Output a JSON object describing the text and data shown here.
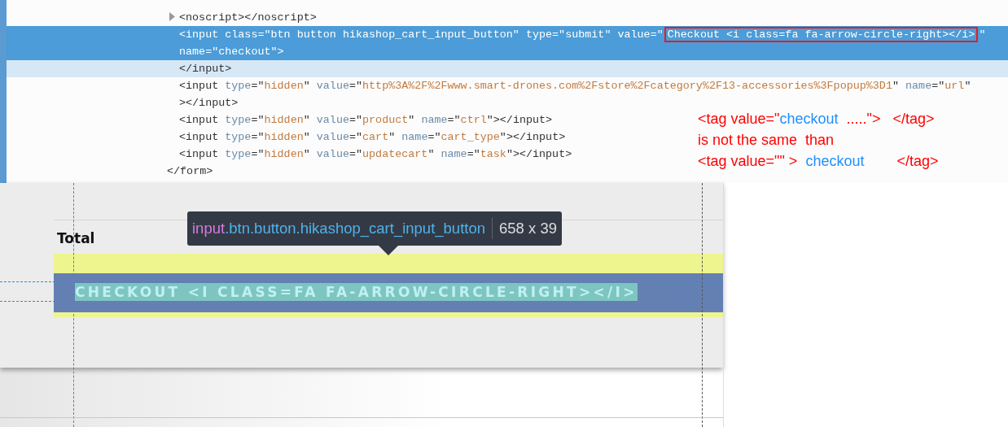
{
  "elements_panel": {
    "form_children": [
      {
        "selected": false,
        "hovered": false,
        "expanded": false,
        "rows": [
          {
            "tokens": [
              {
                "kind": "tag",
                "text": "<noscript></noscript>"
              }
            ]
          }
        ]
      },
      {
        "selected": true,
        "hovered": false,
        "rows": [
          {
            "tokens": [
              {
                "kind": "tag",
                "text": "<input "
              },
              {
                "kind": "attr",
                "text": "class"
              },
              {
                "kind": "tag",
                "text": "=\""
              },
              {
                "kind": "value",
                "text": "btn button hikashop_cart_input_button"
              },
              {
                "kind": "tag",
                "text": "\" "
              },
              {
                "kind": "attr",
                "text": "type"
              },
              {
                "kind": "tag",
                "text": "=\""
              },
              {
                "kind": "value",
                "text": "submit"
              },
              {
                "kind": "tag",
                "text": "\" "
              },
              {
                "kind": "attr",
                "text": "value"
              },
              {
                "kind": "tag",
                "text": "=\""
              },
              {
                "kind": "boxed",
                "text": "Checkout <i class=fa fa-arrow-circle-right></i>"
              },
              {
                "kind": "tag",
                "text": "\""
              }
            ]
          },
          {
            "tokens": [
              {
                "kind": "attr",
                "text": "name"
              },
              {
                "kind": "tag",
                "text": "=\""
              },
              {
                "kind": "value",
                "text": "checkout"
              },
              {
                "kind": "tag",
                "text": "\">"
              }
            ]
          }
        ]
      },
      {
        "selected": false,
        "hovered": true,
        "rows": [
          {
            "tokens": [
              {
                "kind": "tag",
                "text": "</input>"
              }
            ]
          }
        ]
      },
      {
        "selected": false,
        "hovered": false,
        "rows": [
          {
            "tokens": [
              {
                "kind": "tag",
                "text": "<input "
              },
              {
                "kind": "attr",
                "text": "type"
              },
              {
                "kind": "tag",
                "text": "=\""
              },
              {
                "kind": "value",
                "text": "hidden"
              },
              {
                "kind": "tag",
                "text": "\" "
              },
              {
                "kind": "attr",
                "text": "value"
              },
              {
                "kind": "tag",
                "text": "=\""
              },
              {
                "kind": "value",
                "text": "http%3A%2F%2Fwww.smart-drones.com%2Fstore%2Fcategory%2F13-accessories%3Fpopup%3D1"
              },
              {
                "kind": "tag",
                "text": "\" "
              },
              {
                "kind": "attr",
                "text": "name"
              },
              {
                "kind": "tag",
                "text": "=\""
              },
              {
                "kind": "value",
                "text": "url"
              },
              {
                "kind": "tag",
                "text": "\""
              }
            ]
          },
          {
            "tokens": [
              {
                "kind": "tag",
                "text": "></input>"
              }
            ]
          }
        ]
      },
      {
        "selected": false,
        "hovered": false,
        "rows": [
          {
            "tokens": [
              {
                "kind": "tag",
                "text": "<input "
              },
              {
                "kind": "attr",
                "text": "type"
              },
              {
                "kind": "tag",
                "text": "=\""
              },
              {
                "kind": "value",
                "text": "hidden"
              },
              {
                "kind": "tag",
                "text": "\" "
              },
              {
                "kind": "attr",
                "text": "value"
              },
              {
                "kind": "tag",
                "text": "=\""
              },
              {
                "kind": "value",
                "text": "product"
              },
              {
                "kind": "tag",
                "text": "\" "
              },
              {
                "kind": "attr",
                "text": "name"
              },
              {
                "kind": "tag",
                "text": "=\""
              },
              {
                "kind": "value",
                "text": "ctrl"
              },
              {
                "kind": "tag",
                "text": "\"></input>"
              }
            ]
          }
        ]
      },
      {
        "selected": false,
        "hovered": false,
        "rows": [
          {
            "tokens": [
              {
                "kind": "tag",
                "text": "<input "
              },
              {
                "kind": "attr",
                "text": "type"
              },
              {
                "kind": "tag",
                "text": "=\""
              },
              {
                "kind": "value",
                "text": "hidden"
              },
              {
                "kind": "tag",
                "text": "\" "
              },
              {
                "kind": "attr",
                "text": "value"
              },
              {
                "kind": "tag",
                "text": "=\""
              },
              {
                "kind": "value",
                "text": "cart"
              },
              {
                "kind": "tag",
                "text": "\" "
              },
              {
                "kind": "attr",
                "text": "name"
              },
              {
                "kind": "tag",
                "text": "=\""
              },
              {
                "kind": "value",
                "text": "cart_type"
              },
              {
                "kind": "tag",
                "text": "\"></input>"
              }
            ]
          }
        ]
      },
      {
        "selected": false,
        "hovered": false,
        "rows": [
          {
            "tokens": [
              {
                "kind": "tag",
                "text": "<input "
              },
              {
                "kind": "attr",
                "text": "type"
              },
              {
                "kind": "tag",
                "text": "=\""
              },
              {
                "kind": "value",
                "text": "hidden"
              },
              {
                "kind": "tag",
                "text": "\" "
              },
              {
                "kind": "attr",
                "text": "value"
              },
              {
                "kind": "tag",
                "text": "=\""
              },
              {
                "kind": "value",
                "text": "updatecart"
              },
              {
                "kind": "tag",
                "text": "\" "
              },
              {
                "kind": "attr",
                "text": "name"
              },
              {
                "kind": "tag",
                "text": "=\""
              },
              {
                "kind": "value",
                "text": "task"
              },
              {
                "kind": "tag",
                "text": "\"></input>"
              }
            ]
          }
        ]
      }
    ],
    "closing_line": {
      "selected": false,
      "hovered": false,
      "rows": [
        {
          "tokens": [
            {
              "kind": "tag",
              "text": "</form>"
            }
          ]
        }
      ]
    }
  },
  "annotation": {
    "lines": [
      {
        "segments": [
          {
            "text": "<tag value=\"",
            "color": "#ff0000"
          },
          {
            "text": "checkout",
            "color": "#1e90ff"
          },
          {
            "text": "  .....\">   </tag>",
            "color": "#ff0000"
          }
        ]
      },
      {
        "segments": [
          {
            "text": "is not the same  than",
            "color": "#ff0000"
          }
        ]
      },
      {
        "segments": [
          {
            "text": "<tag value=\"\" >  ",
            "color": "#ff0000"
          },
          {
            "text": "checkout",
            "color": "#1e90ff"
          },
          {
            "text": "        </tag>",
            "color": "#ff0000"
          }
        ]
      }
    ]
  },
  "page_preview": {
    "total_label": "Total",
    "tooltip": {
      "tag": "input",
      "classes": ".btn.button.hikashop_cart_input_button",
      "size": "658 x 39"
    },
    "button": {
      "label": "CHECKOUT <I CLASS=FA FA-ARROW-CIRCLE-RIGHT></I>"
    }
  }
}
